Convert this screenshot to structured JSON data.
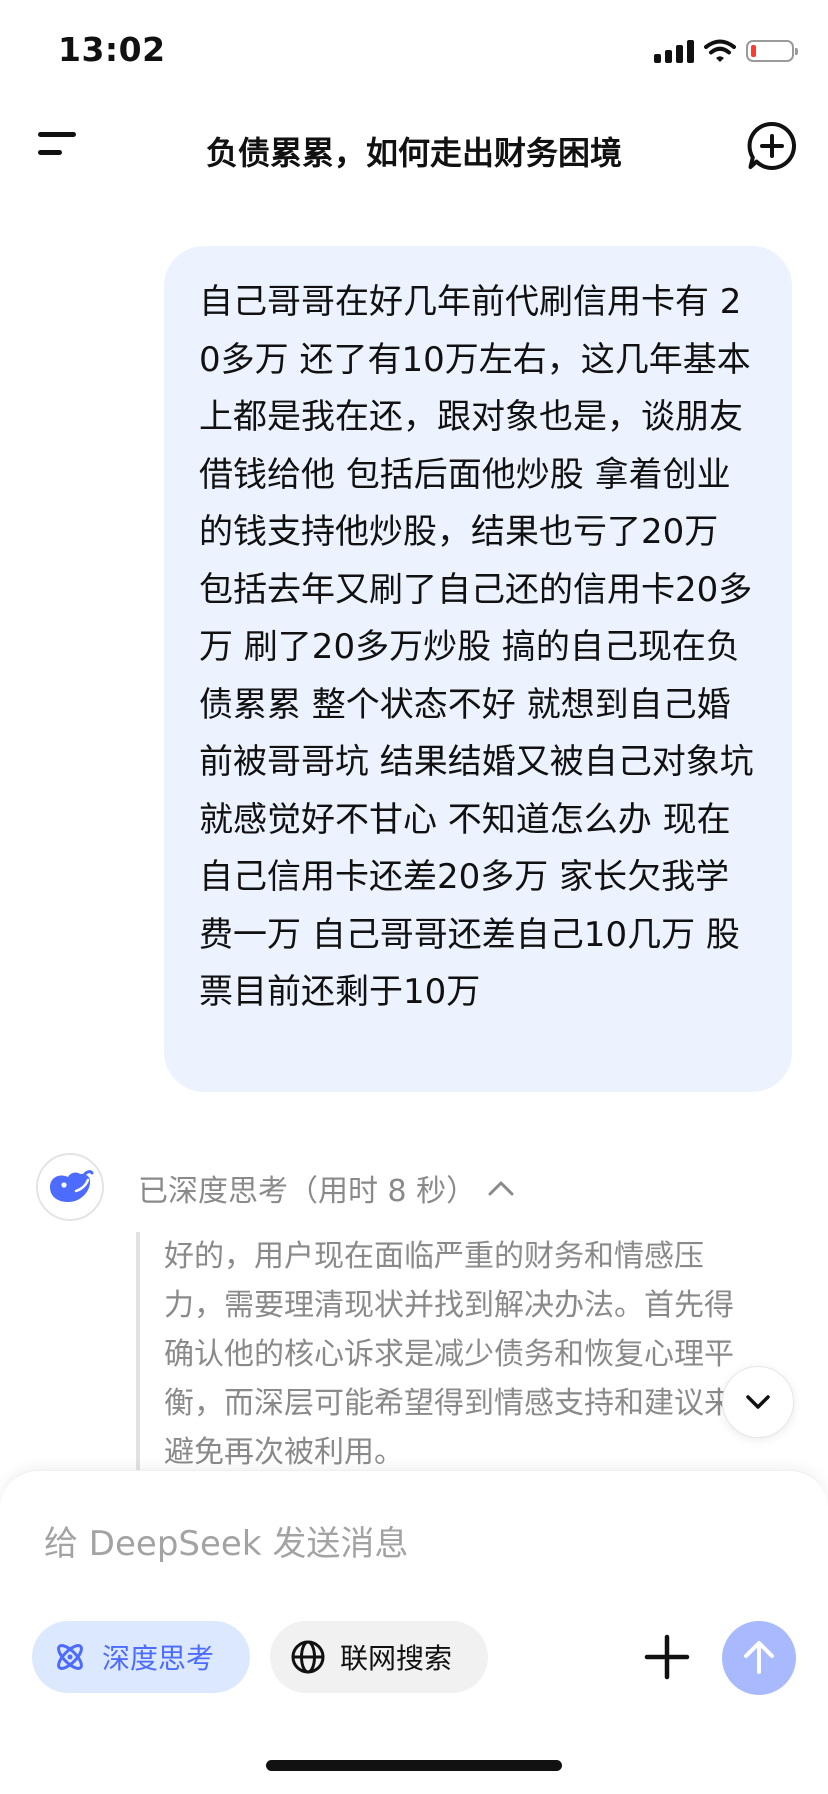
{
  "status_bar": {
    "time": "13:02",
    "icons": [
      "signal-icon",
      "wifi-icon",
      "battery-low-icon"
    ],
    "battery_color": "#ff3b30"
  },
  "header": {
    "title": "负债累累，如何走出财务困境",
    "icons": [
      "menu-icon",
      "new-chat-icon"
    ]
  },
  "conversation": {
    "user_message": "自己哥哥在好几年前代刷信用卡有 20多万 还了有10万左右，这几年基本上都是我在还，跟对象也是，谈朋友借钱给他 包括后面他炒股 拿着创业的钱支持他炒股，结果也亏了20万 包括去年又刷了自己还的信用卡20多万 刷了20多万炒股 搞的自己现在负债累累 整个状态不好 就想到自己婚前被哥哥坑 结果结婚又被自己对象坑 就感觉好不甘心 不知道怎么办 现在自己信用卡还差20多万 家长欠我学费一万 自己哥哥还差自己10几万 股票目前还剩于10万",
    "assistant": {
      "avatar_icon": "deepseek-whale-icon",
      "thinking_label": "已深度思考（用时 8 秒）",
      "thinking_text": "好的，用户现在面临严重的财务和情感压力，需要理清现状并找到解决办法。首先得确认他的核心诉求是减少债务和恢复心理平衡，而深层可能希望得到情感支持和建议来避免再次被利用。"
    }
  },
  "composer": {
    "placeholder": "给 DeepSeek 发送消息",
    "deep_think_label": "深度思考",
    "web_search_label": "联网搜索",
    "accent_color": "#4d6bfe",
    "send_button_color": "#a8bafd"
  }
}
